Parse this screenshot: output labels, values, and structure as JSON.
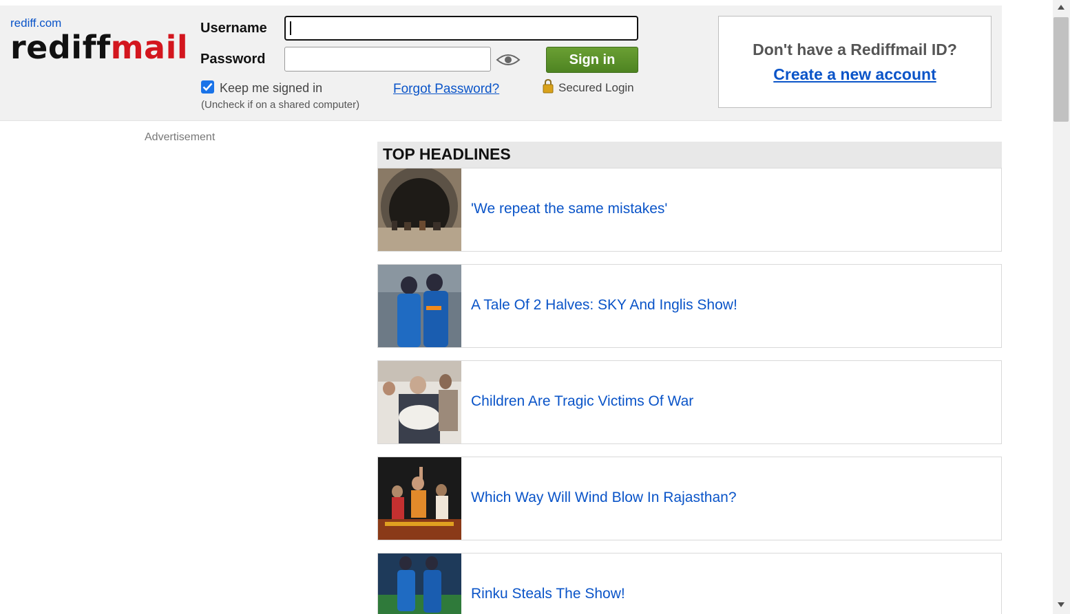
{
  "header": {
    "site_link": "rediff.com",
    "logo_part1": "rediff",
    "logo_part2": "mail",
    "username_label": "Username",
    "password_label": "Password",
    "username_value": "",
    "password_value": "",
    "signin_label": "Sign in",
    "keep_signed_in_label": "Keep me signed in",
    "keep_signed_in_checked": true,
    "uncheck_note": "(Uncheck if on a shared computer)",
    "forgot_password": "Forgot Password?",
    "secured_login": "Secured Login",
    "signup_question": "Don't have a Rediffmail ID?",
    "signup_link": "Create a new account"
  },
  "advertisement_label": "Advertisement",
  "headlines": {
    "title": "TOP HEADLINES",
    "items": [
      {
        "title": "'We repeat the same mistakes'",
        "thumb": "tunnel-photo"
      },
      {
        "title": "A Tale Of 2 Halves: SKY And Inglis Show!",
        "thumb": "cricket-players-photo"
      },
      {
        "title": "Children Are Tragic Victims Of War",
        "thumb": "war-crowd-photo"
      },
      {
        "title": "Which Way Will Wind Blow In Rajasthan?",
        "thumb": "rally-photo"
      },
      {
        "title": "Rinku Steals The Show!",
        "thumb": "cricket-walk-photo"
      }
    ]
  },
  "colors": {
    "link": "#0a54c8",
    "logo_red": "#d3161e",
    "signin_green": "#5a9128",
    "header_bg": "#f1f1f1"
  }
}
